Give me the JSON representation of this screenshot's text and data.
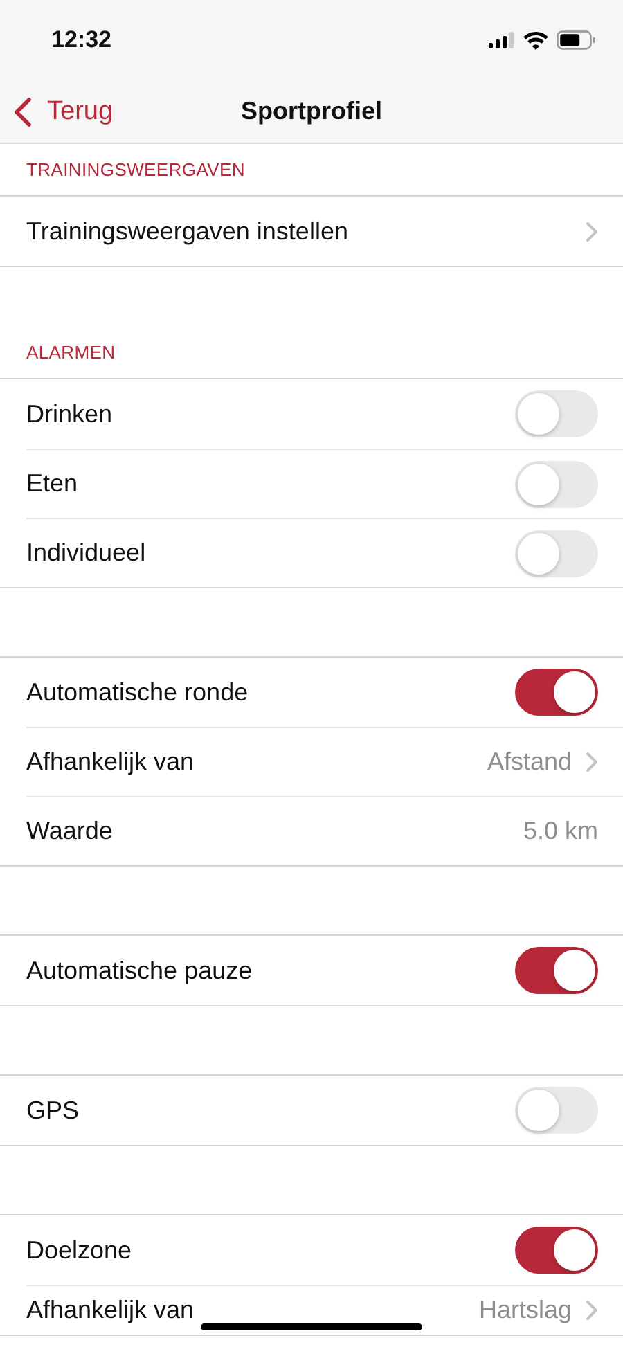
{
  "status_bar": {
    "time": "12:32"
  },
  "nav": {
    "back": "Terug",
    "title": "Sportprofiel"
  },
  "sections": [
    {
      "header": "TRAININGSWEERGAVEN",
      "rows": [
        {
          "kind": "link",
          "label": "Trainingsweergaven instellen"
        }
      ]
    },
    {
      "header": "ALARMEN",
      "rows": [
        {
          "kind": "toggle",
          "label": "Drinken",
          "on": false
        },
        {
          "kind": "toggle",
          "label": "Eten",
          "on": false
        },
        {
          "kind": "toggle",
          "label": "Individueel",
          "on": false
        }
      ]
    },
    {
      "rows": [
        {
          "kind": "toggle",
          "label": "Automatische ronde",
          "on": true
        },
        {
          "kind": "link",
          "label": "Afhankelijk van",
          "value": "Afstand"
        },
        {
          "kind": "value",
          "label": "Waarde",
          "value": "5.0 km"
        }
      ]
    },
    {
      "rows": [
        {
          "kind": "toggle",
          "label": "Automatische pauze",
          "on": true
        }
      ]
    },
    {
      "rows": [
        {
          "kind": "toggle",
          "label": "GPS",
          "on": false
        }
      ]
    },
    {
      "rows": [
        {
          "kind": "toggle",
          "label": "Doelzone",
          "on": true
        },
        {
          "kind": "link",
          "label": "Afhankelijk van",
          "value": "Hartslag"
        }
      ]
    }
  ]
}
